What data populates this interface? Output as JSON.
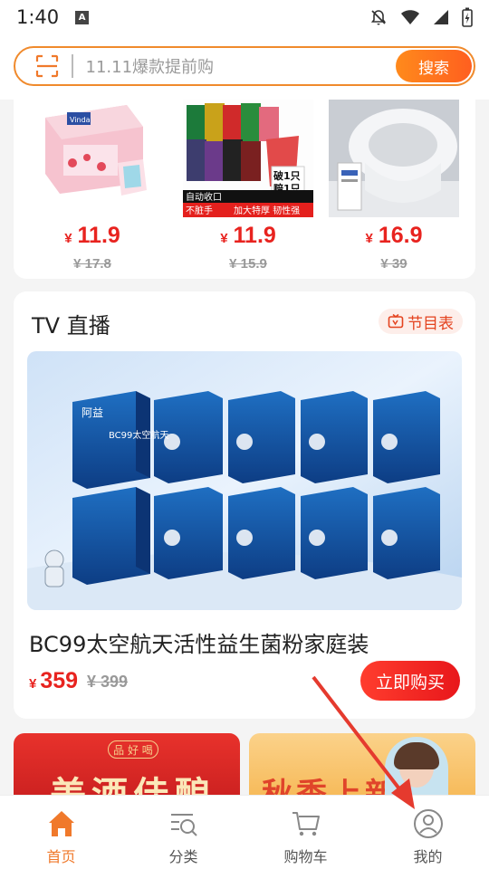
{
  "status_bar": {
    "time": "1:40",
    "icons": [
      "a-notification-icon",
      "do-not-disturb-icon",
      "wifi-icon",
      "signal-icon",
      "battery-charging-icon"
    ]
  },
  "search": {
    "placeholder": "11.11爆款提前购",
    "button_label": "搜索",
    "accent": "#f08a2c"
  },
  "products": [
    {
      "price": "11.9",
      "original_price": "¥ 17.8"
    },
    {
      "price": "11.9",
      "original_price": "¥ 15.9",
      "badges": [
        "自动收口",
        "不脏手",
        "加大特厚 韧性强",
        "破1只",
        "赔1只"
      ]
    },
    {
      "price": "16.9",
      "original_price": "¥ 39"
    }
  ],
  "currency": "¥",
  "tv_live": {
    "title": "TV 直播",
    "schedule_label": "节目表",
    "product_title": "BC99太空航天活性益生菌粉家庭装",
    "price": "359",
    "original_price": "¥ 399",
    "buy_label": "立即购买",
    "banner_box_text": "BC99太空航天",
    "banner_brand": "阿益"
  },
  "promos": {
    "left_text": "美酒佳酿",
    "left_sub": "品 好 喝",
    "right_text": "秋季上新"
  },
  "bottom_nav": [
    {
      "label": "首页",
      "icon": "home-icon",
      "active": true
    },
    {
      "label": "分类",
      "icon": "category-search-icon",
      "active": false
    },
    {
      "label": "购物车",
      "icon": "cart-icon",
      "active": false
    },
    {
      "label": "我的",
      "icon": "profile-icon",
      "active": false
    }
  ],
  "colors": {
    "price_red": "#e8231f",
    "active_nav": "#f0792b"
  }
}
